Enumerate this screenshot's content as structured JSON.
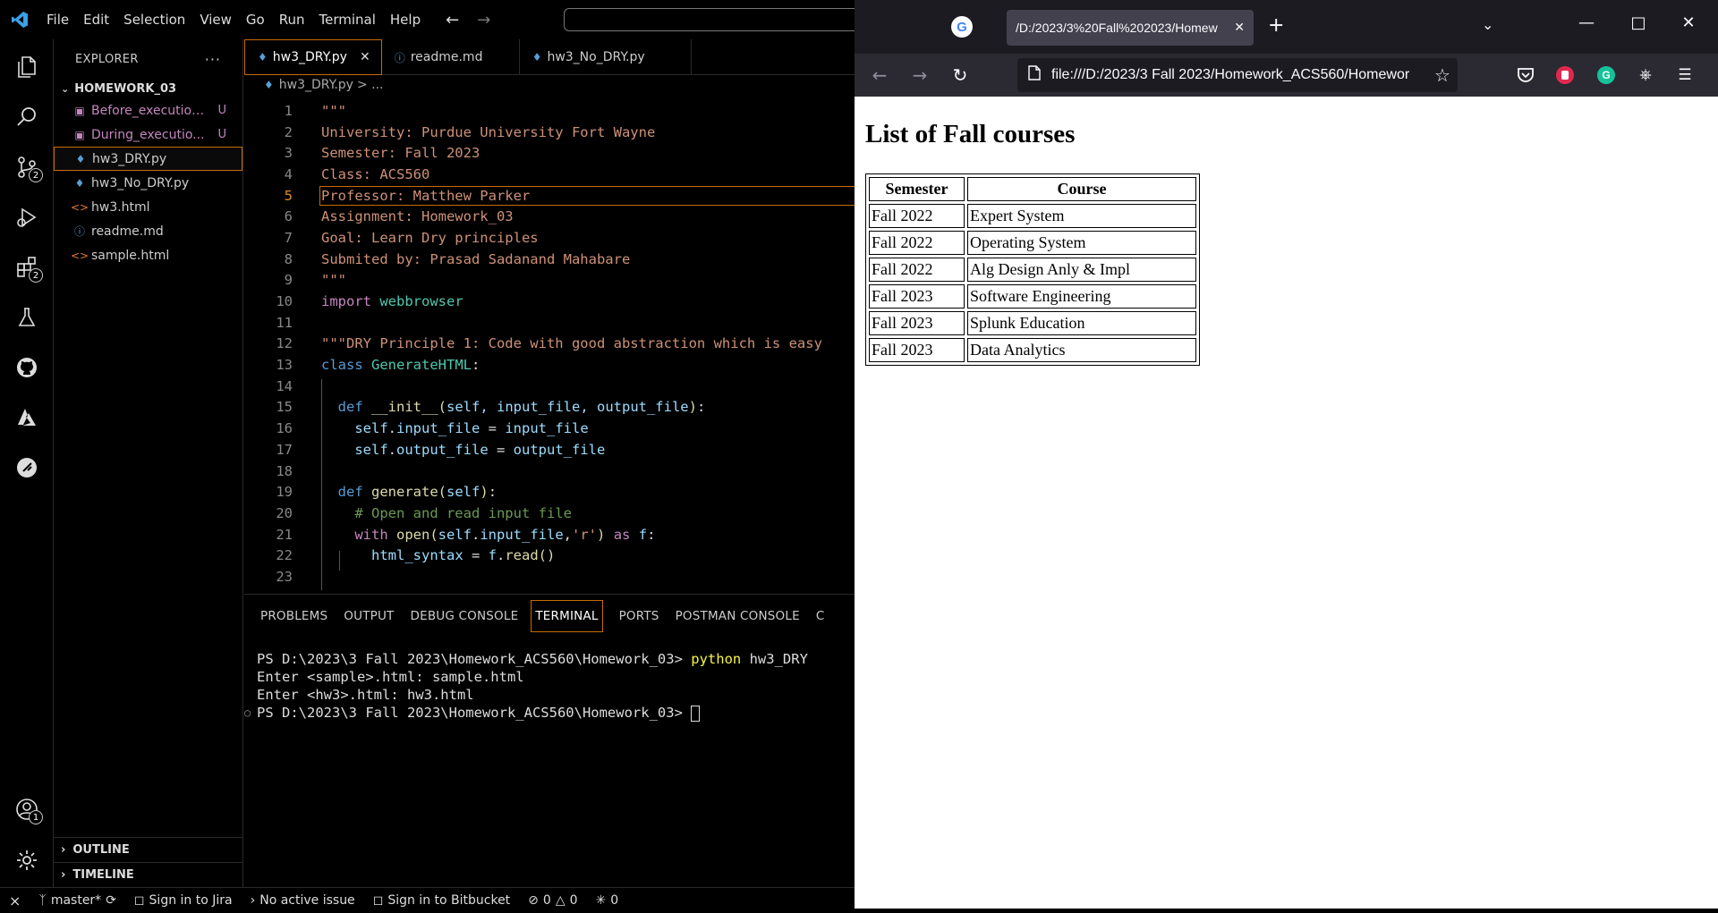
{
  "vscode": {
    "menu": [
      "File",
      "Edit",
      "Selection",
      "View",
      "Go",
      "Run",
      "Terminal",
      "Help"
    ],
    "sidebar": {
      "title": "EXPLORER",
      "folder": "HOMEWORK_03",
      "files": [
        {
          "name": "Before_execution...",
          "status": "U",
          "icon": "image"
        },
        {
          "name": "During_executio...",
          "status": "U",
          "icon": "image"
        },
        {
          "name": "hw3_DRY.py",
          "status": "",
          "icon": "python"
        },
        {
          "name": "hw3_No_DRY.py",
          "status": "",
          "icon": "python"
        },
        {
          "name": "hw3.html",
          "status": "",
          "icon": "html"
        },
        {
          "name": "readme.md",
          "status": "",
          "icon": "info"
        },
        {
          "name": "sample.html",
          "status": "",
          "icon": "html"
        }
      ],
      "outline": "OUTLINE",
      "timeline": "TIMELINE"
    },
    "activity_badges": {
      "source_control": "2",
      "extensions": "2",
      "accounts": "1"
    },
    "tabs": [
      {
        "label": "hw3_DRY.py",
        "icon": "python"
      },
      {
        "label": "readme.md",
        "icon": "info"
      },
      {
        "label": "hw3_No_DRY.py",
        "icon": "python"
      }
    ],
    "breadcrumb": {
      "file": "hw3_DRY.py",
      "rest": "> ..."
    },
    "code_line_numbers": [
      "1",
      "2",
      "3",
      "4",
      "5",
      "6",
      "7",
      "8",
      "9",
      "10",
      "11",
      "12",
      "13",
      "14",
      "15",
      "16",
      "17",
      "18",
      "19",
      "20",
      "21",
      "22",
      "23"
    ],
    "code": {
      "l1": "\"\"\"",
      "l2": "University: Purdue University Fort Wayne",
      "l3": "Semester: Fall 2023",
      "l4": "Class: ACS560",
      "l5": "Professor: Matthew Parker",
      "l6": "Assignment: Homework_03",
      "l7": "Goal: Learn Dry principles",
      "l8": "Submited by: Prasad Sadanand Mahabare",
      "l9": "\"\"\"",
      "l10_kw": "import",
      "l10_mod": "webbrowser",
      "l12": "\"\"\"DRY Principle 1: Code with good abstraction which is easy",
      "l13_kw": "class",
      "l13_cls": "GenerateHTML",
      "l15_kw": "def",
      "l15_fn": "__init__",
      "l15_args": "self, input_file, output_file",
      "l16_a": "self",
      "l16_b": "input_file",
      "l16_c": "input_file",
      "l17_a": "self",
      "l17_b": "output_file",
      "l17_c": "output_file",
      "l19_kw": "def",
      "l19_fn": "generate",
      "l19_arg": "self",
      "l20": "# Open and read input file",
      "l21_kw": "with",
      "l21_fn": "open",
      "l21_a": "self",
      "l21_b": "input_file",
      "l21_str": "'r'",
      "l21_as": "as",
      "l21_f": "f",
      "l22_a": "html_syntax",
      "l22_f": "f",
      "l22_fn": "read"
    },
    "panel_tabs": [
      "PROBLEMS",
      "OUTPUT",
      "DEBUG CONSOLE",
      "TERMINAL",
      "PORTS",
      "POSTMAN CONSOLE",
      "C"
    ],
    "terminal": {
      "l1_prompt": "PS D:\\2023\\3 Fall 2023\\Homework_ACS560\\Homework_03> ",
      "l1_cmd": "python",
      "l1_rest": " hw3_DRY",
      "l2": "Enter <sample>.html: sample.html",
      "l3": "Enter <hw3>.html: hw3.html",
      "l4_prompt": "PS D:\\2023\\3 Fall 2023\\Homework_ACS560\\Homework_03> "
    },
    "statusbar": {
      "branch": "master*",
      "jira": "Sign in to Jira",
      "issue": "No active issue",
      "bitbucket": "Sign in to Bitbucket",
      "errors": "0",
      "warnings": "0",
      "ports": "0"
    }
  },
  "firefox": {
    "tab_title": "/D:/2023/3%20Fall%202023/Homew",
    "url": "file:///D:/2023/3 Fall 2023/Homework_ACS560/Homewor",
    "page": {
      "heading": "List of Fall courses",
      "headers": [
        "Semester",
        "Course"
      ],
      "rows": [
        [
          "Fall 2022",
          "Expert System"
        ],
        [
          "Fall 2022",
          "Operating System"
        ],
        [
          "Fall 2022",
          "Alg Design Anly & Impl"
        ],
        [
          "Fall 2023",
          "Software Engineering"
        ],
        [
          "Fall 2023",
          "Splunk Education"
        ],
        [
          "Fall 2023",
          "Data Analytics"
        ]
      ]
    }
  },
  "colors": {
    "accent_orange": "#c76c00",
    "ff_dark": "#1c1b22",
    "ff_toolbar": "#2b2a33"
  }
}
